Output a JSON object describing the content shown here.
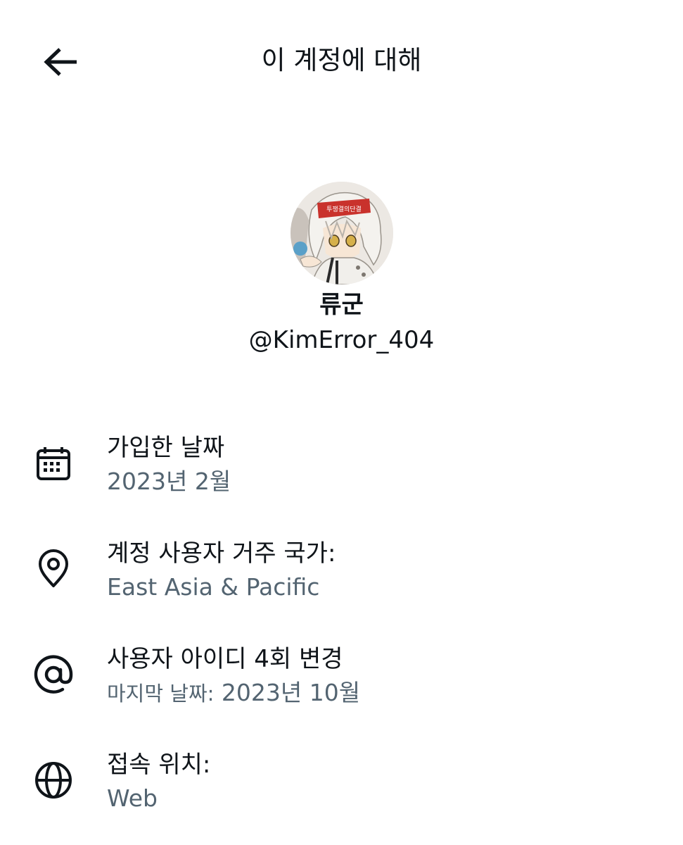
{
  "header": {
    "title": "이 계정에 대해",
    "back_icon": "arrow-left-icon"
  },
  "profile": {
    "display_name": "류군",
    "handle": "@KimError_404",
    "avatar_badge_text": "투쟁결의단결"
  },
  "info": {
    "joined": {
      "icon": "calendar-icon",
      "label": "가입한 날짜",
      "value": "2023년 2월"
    },
    "country": {
      "icon": "location-pin-icon",
      "label": "계정 사용자 거주 국가:",
      "value": "East Asia & Pacific"
    },
    "username_changes": {
      "icon": "at-sign-icon",
      "label": "사용자 아이디 4회 변경",
      "value_prefix": "마지막 날짜:",
      "value": "2023년 10월"
    },
    "connected_via": {
      "icon": "globe-icon",
      "label": "접속 위치:",
      "value": "Web"
    }
  },
  "colors": {
    "primary_text": "#0f1419",
    "secondary_text": "#536471",
    "background": "#ffffff"
  }
}
